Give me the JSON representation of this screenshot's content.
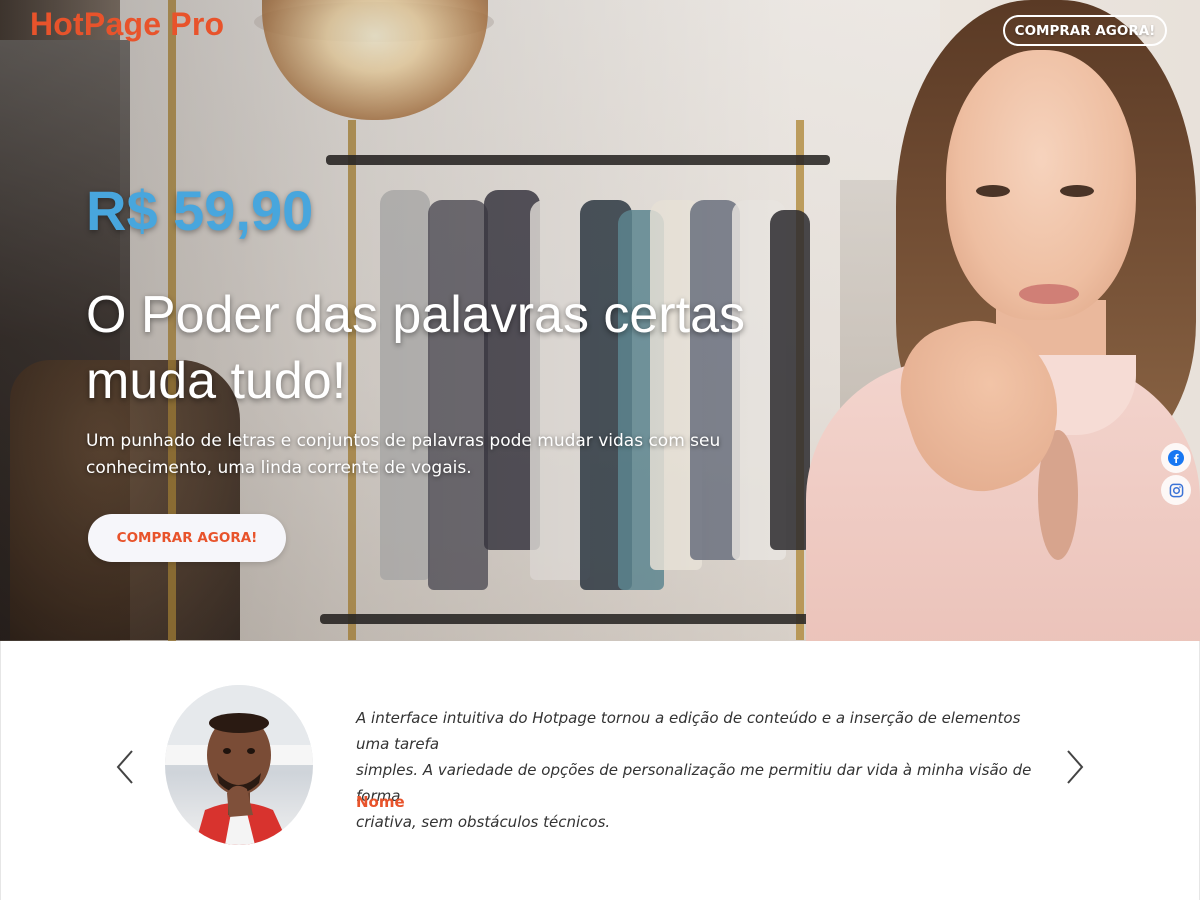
{
  "header": {
    "logo": "HotPage Pro",
    "cta_label": "COMPRAR AGORA!"
  },
  "hero": {
    "price": "R$ 59,90",
    "headline_line1": "O Poder das palavras certas",
    "headline_line2": "muda tudo!",
    "subtext_line1": "Um punhado de letras e conjuntos de palavras pode mudar vidas com seu",
    "subtext_line2": "conhecimento, uma linda corrente de vogais.",
    "cta_label": "COMPRAR AGORA!"
  },
  "social": {
    "items": [
      {
        "icon": "facebook-icon",
        "color": "#1877f2"
      },
      {
        "icon": "instagram-icon",
        "color": "#3b73d6"
      }
    ]
  },
  "testimonial": {
    "quote_line1": "A interface intuitiva do Hotpage tornou a edição de conteúdo e a inserção de elementos uma tarefa",
    "quote_line2": "simples. A variedade de opções de personalização me permitiu dar vida à minha visão de forma",
    "quote_line3": "criativa, sem obstáculos técnicos.",
    "author": "Nome",
    "prev_icon": "chevron-left-icon",
    "next_icon": "chevron-right-icon"
  },
  "colors": {
    "brand": "#e8532b",
    "price": "#48a6dd",
    "hero_button_bg": "#f6f6fa"
  }
}
